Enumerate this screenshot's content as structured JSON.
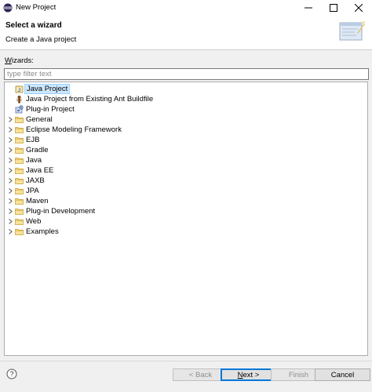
{
  "window": {
    "title": "New Project",
    "controls": {
      "minimize": "minimize-icon",
      "maximize": "maximize-icon",
      "close": "close-icon"
    }
  },
  "header": {
    "title": "Select a wizard",
    "description": "Create a Java project",
    "banner_icon": "wizard-banner-icon"
  },
  "wizards": {
    "label_mnemonic": "W",
    "label_rest": "izards:",
    "filter_placeholder": "type filter text",
    "filter_value": ""
  },
  "tree": {
    "items": [
      {
        "label": "Java Project",
        "icon": "java-project-icon",
        "expandable": false,
        "selected": true
      },
      {
        "label": "Java Project from Existing Ant Buildfile",
        "icon": "ant-icon",
        "expandable": false,
        "selected": false
      },
      {
        "label": "Plug-in Project",
        "icon": "plugin-project-icon",
        "expandable": false,
        "selected": false
      },
      {
        "label": "General",
        "icon": "folder-icon",
        "expandable": true,
        "selected": false
      },
      {
        "label": "Eclipse Modeling Framework",
        "icon": "folder-icon",
        "expandable": true,
        "selected": false
      },
      {
        "label": "EJB",
        "icon": "folder-icon",
        "expandable": true,
        "selected": false
      },
      {
        "label": "Gradle",
        "icon": "folder-icon",
        "expandable": true,
        "selected": false
      },
      {
        "label": "Java",
        "icon": "folder-icon",
        "expandable": true,
        "selected": false
      },
      {
        "label": "Java EE",
        "icon": "folder-icon",
        "expandable": true,
        "selected": false
      },
      {
        "label": "JAXB",
        "icon": "folder-icon",
        "expandable": true,
        "selected": false
      },
      {
        "label": "JPA",
        "icon": "folder-icon",
        "expandable": true,
        "selected": false
      },
      {
        "label": "Maven",
        "icon": "folder-icon",
        "expandable": true,
        "selected": false
      },
      {
        "label": "Plug-in Development",
        "icon": "folder-icon",
        "expandable": true,
        "selected": false
      },
      {
        "label": "Web",
        "icon": "folder-icon",
        "expandable": true,
        "selected": false
      },
      {
        "label": "Examples",
        "icon": "folder-icon",
        "expandable": true,
        "selected": false
      }
    ]
  },
  "footer": {
    "help_icon": "help-icon",
    "back_label": "< Back",
    "next_label": "Next >",
    "finish_label": "Finish",
    "cancel_label": "Cancel",
    "back_enabled": false,
    "finish_enabled": false
  },
  "colors": {
    "selection_bg": "#cce8ff",
    "selection_border": "#99d1ff",
    "default_button_border": "#0078d7",
    "folder": "#e8c268"
  }
}
